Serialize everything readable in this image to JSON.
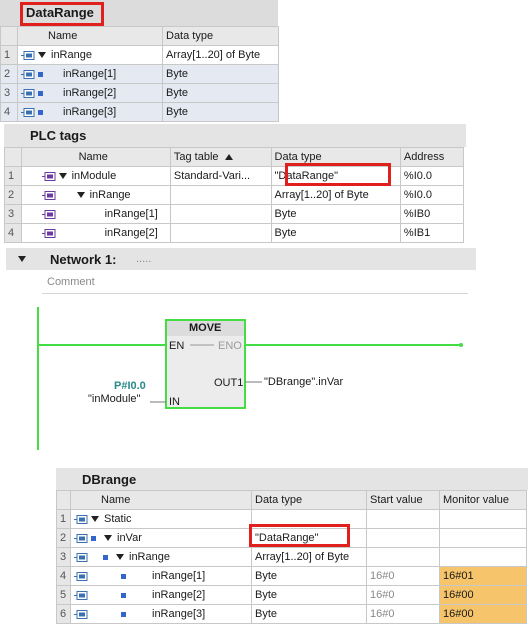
{
  "datarange": {
    "title": "DataRange",
    "columns": [
      "Name",
      "Data type"
    ],
    "rows": [
      {
        "idx": "1",
        "expand": true,
        "name": "inRange",
        "type": "Array[1..20] of Byte"
      },
      {
        "idx": "2",
        "name": "inRange[1]",
        "type": "Byte"
      },
      {
        "idx": "3",
        "name": "inRange[2]",
        "type": "Byte"
      },
      {
        "idx": "4",
        "name": "inRange[3]",
        "type": "Byte"
      }
    ]
  },
  "plctags": {
    "title": "PLC tags",
    "columns": [
      "Name",
      "Tag table",
      "Data type",
      "Address"
    ],
    "rows": [
      {
        "idx": "1",
        "name": "inModule",
        "table": "Standard-Vari...",
        "type": "\"DataRange\"",
        "address": "%I0.0"
      },
      {
        "idx": "2",
        "name": "inRange",
        "table": "",
        "type": "Array[1..20] of Byte",
        "address": "%I0.0"
      },
      {
        "idx": "3",
        "name": "inRange[1]",
        "table": "",
        "type": "Byte",
        "address": "%IB0"
      },
      {
        "idx": "4",
        "name": "inRange[2]",
        "table": "",
        "type": "Byte",
        "address": "%IB1"
      }
    ]
  },
  "network": {
    "title": "Network 1:",
    "dots": ".....",
    "comment": "Comment",
    "block": {
      "name": "MOVE",
      "en": "EN",
      "eno": "ENO",
      "in": "IN",
      "out1": "OUT1",
      "in_const": "P#I0.0",
      "in_operand": "\"inModule\"",
      "out_operand": "\"DBrange\".inVar"
    }
  },
  "dbrange": {
    "title": "DBrange",
    "columns": [
      "Name",
      "Data type",
      "Start value",
      "Monitor value"
    ],
    "rows": [
      {
        "idx": "1",
        "name": "Static",
        "type": "",
        "start": "",
        "monitor": ""
      },
      {
        "idx": "2",
        "name": "inVar",
        "type": "\"DataRange\"",
        "start": "",
        "monitor": ""
      },
      {
        "idx": "3",
        "name": "inRange",
        "type": "Array[1..20] of Byte",
        "start": "",
        "monitor": ""
      },
      {
        "idx": "4",
        "name": "inRange[1]",
        "type": "Byte",
        "start": "16#0",
        "monitor": "16#01"
      },
      {
        "idx": "5",
        "name": "inRange[2]",
        "type": "Byte",
        "start": "16#0",
        "monitor": "16#00"
      },
      {
        "idx": "6",
        "name": "inRange[3]",
        "type": "Byte",
        "start": "16#0",
        "monitor": "16#00"
      }
    ]
  },
  "colors": {
    "highlight_border": "#e0201c",
    "rung": "#44dd44",
    "monitor": "#f6c46a",
    "const": "#2a8a8a"
  }
}
